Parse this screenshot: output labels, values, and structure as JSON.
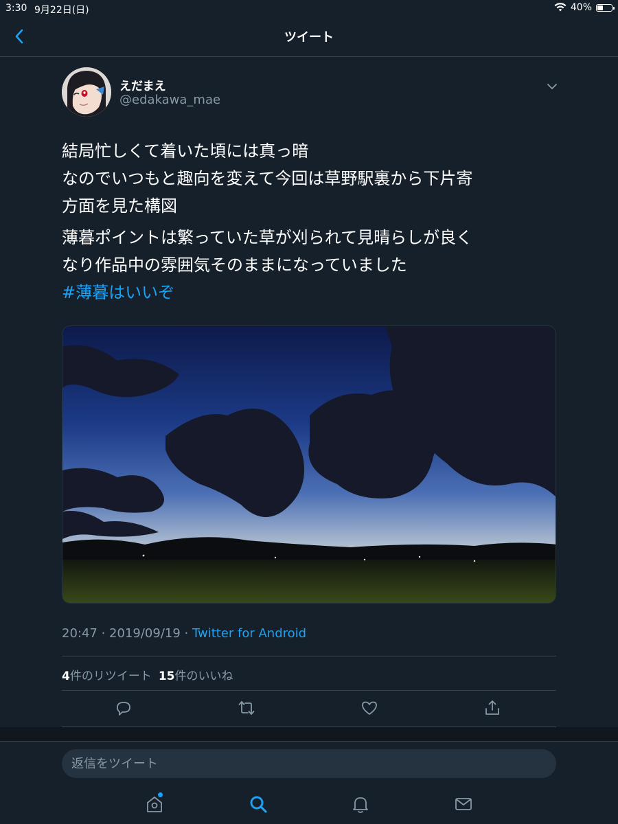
{
  "status_bar": {
    "time": "3:30",
    "date": "9月22日(日)",
    "battery": "40%",
    "battery_level": 0.4
  },
  "nav": {
    "title": "ツイート"
  },
  "tweet": {
    "display_name": "えだまえ",
    "handle": "@edakawa_mae",
    "text_para1": [
      "結局忙しくて着いた頃には真っ暗",
      "なのでいつもと趣向を変えて今回は草野駅裏から下片寄",
      "方面を見た構図"
    ],
    "text_para2": [
      "薄暮ポイントは繁っていた草が刈られて見晴らしが良く",
      "なり作品中の雰囲気そのままになっていました"
    ],
    "hashtag": "#薄暮はいいぞ",
    "timestamp": "20:47 · 2019/09/19 · ",
    "source": "Twitter for Android",
    "retweet_count": "4",
    "retweet_label": "件のリツイート",
    "like_count": "15",
    "like_label": "件のいいね"
  },
  "actions": {
    "icons": [
      "reply-icon",
      "retweet-icon",
      "like-icon",
      "share-icon"
    ]
  },
  "reply": {
    "placeholder": "返信をツイート"
  },
  "tab_bar": {
    "icons": [
      "home-icon",
      "search-icon",
      "notifications-icon",
      "messages-icon"
    ],
    "active": "search-icon"
  },
  "colors": {
    "background": "#15202b",
    "accent": "#1da1f2",
    "secondary_text": "#8899a6",
    "divider": "#38444d"
  }
}
